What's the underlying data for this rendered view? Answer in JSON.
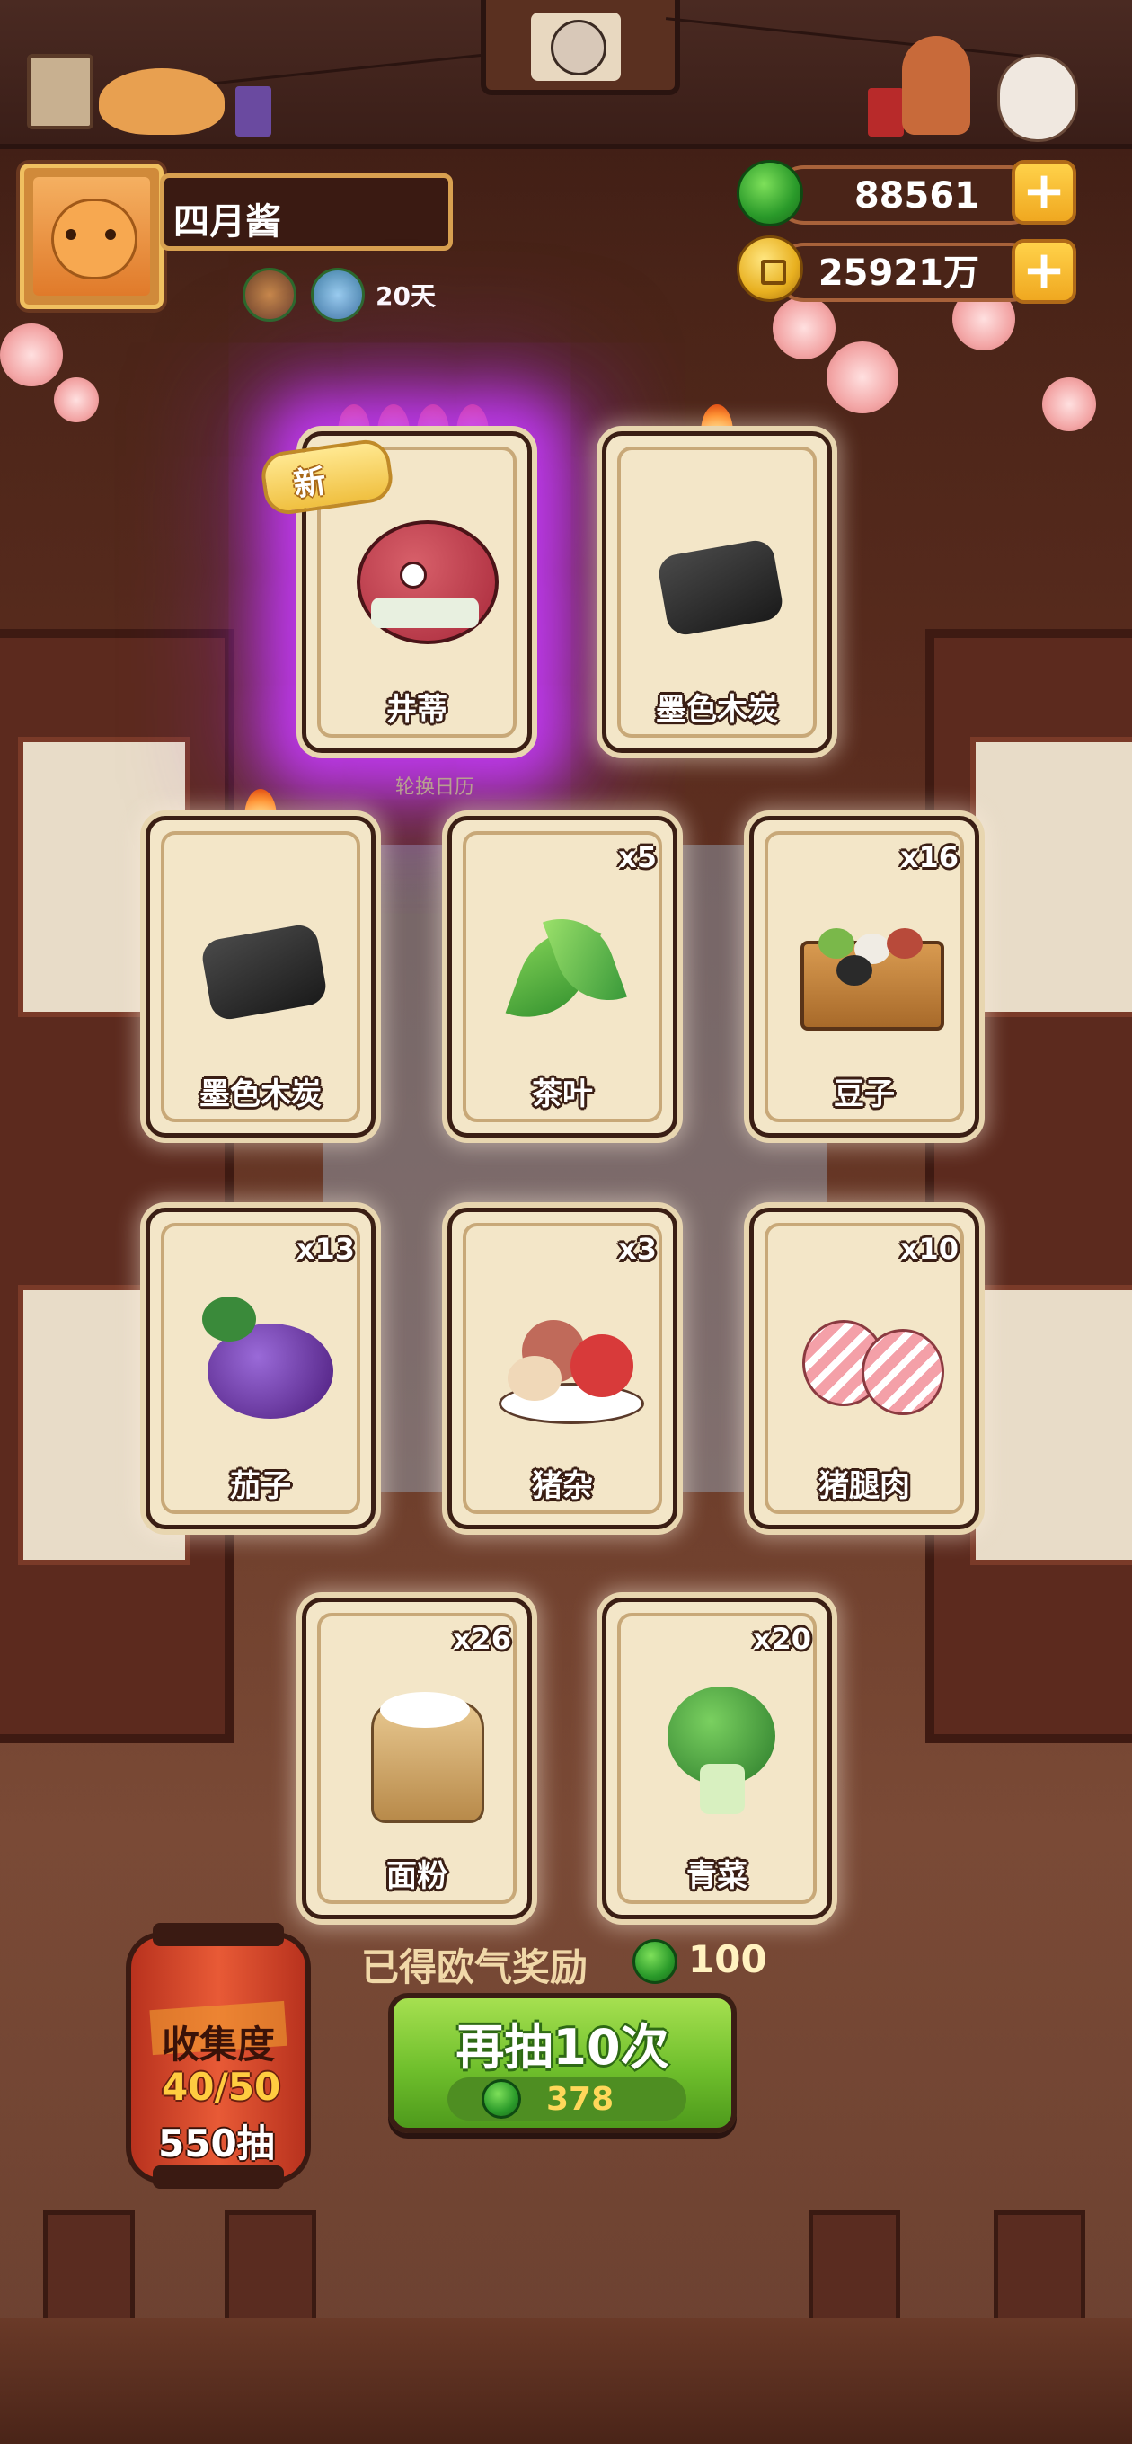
{
  "player": {
    "name": "四月酱",
    "days": "20天"
  },
  "currency": {
    "jade": "88561",
    "gold": "25921万"
  },
  "colors": {
    "accent_green": "#6fbf2c",
    "gold": "#f0a820",
    "card_bg": "#f3e6c8",
    "rare_glow": "#c83cff"
  },
  "cards_row1": [
    {
      "label": "井蒂",
      "count": "",
      "flames": 4,
      "new": "新",
      "rare": true
    },
    {
      "label": "墨色木炭",
      "count": "",
      "flames": 1
    }
  ],
  "sub_label": "轮换日历",
  "cards_row2": [
    {
      "label": "墨色木炭",
      "count": "",
      "flames": 1
    },
    {
      "label": "茶叶",
      "count": "x5"
    },
    {
      "label": "豆子",
      "count": "x16"
    }
  ],
  "cards_row3": [
    {
      "label": "茄子",
      "count": "x13"
    },
    {
      "label": "猪杂",
      "count": "x3"
    },
    {
      "label": "猪腿肉",
      "count": "x10"
    }
  ],
  "cards_row4": [
    {
      "label": "面粉",
      "count": "x26"
    },
    {
      "label": "青菜",
      "count": "x20"
    }
  ],
  "reward": {
    "text": "已得欧气奖励",
    "value": "100"
  },
  "draw_button": {
    "label": "再抽10次",
    "cost": "378"
  },
  "collection": {
    "title": "收集度",
    "progress": "40/50",
    "draws": "550抽"
  },
  "icons": [
    "jade-coin-icon",
    "gold-coin-icon",
    "plus-icon",
    "flame-icon",
    "cat-icon",
    "tea-leaf-icon",
    "charcoal-icon"
  ]
}
